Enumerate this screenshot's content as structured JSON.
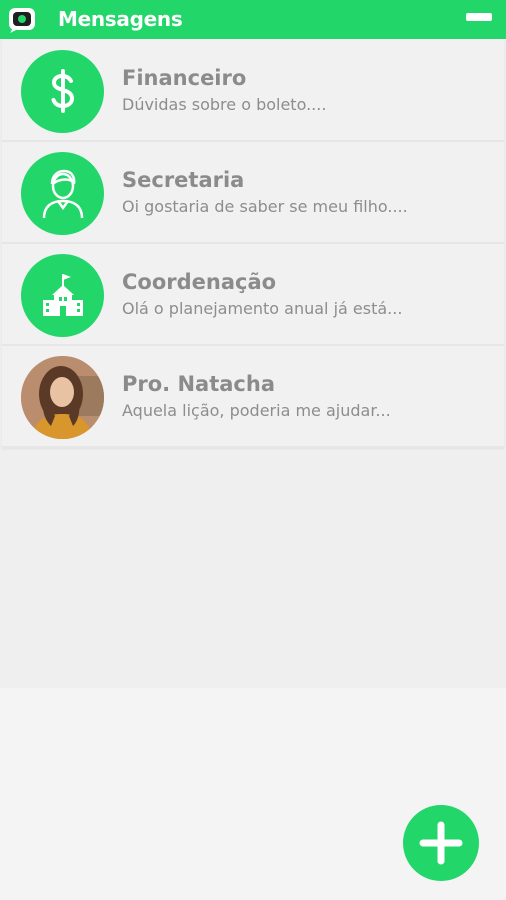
{
  "header": {
    "title": "Mensagens",
    "app_icon": "chat-bubble-icon",
    "menu_icon": "minus-menu-icon"
  },
  "colors": {
    "accent": "#22d66a",
    "text_muted": "#8b8b8b",
    "background": "#f4f4f4"
  },
  "conversations": [
    {
      "name": "Financeiro",
      "preview": "Dúvidas sobre o boleto....",
      "icon": "dollar-icon"
    },
    {
      "name": "Secretaria",
      "preview": "Oi gostaria de saber se meu filho....",
      "icon": "person-icon"
    },
    {
      "name": "Coordenação",
      "preview": "Olá o planejamento anual já está...",
      "icon": "school-icon"
    },
    {
      "name": "Pro. Natacha",
      "preview": "Aquela lição, poderia me ajudar...",
      "icon": "profile-photo"
    }
  ],
  "fab": {
    "icon": "plus-icon"
  }
}
